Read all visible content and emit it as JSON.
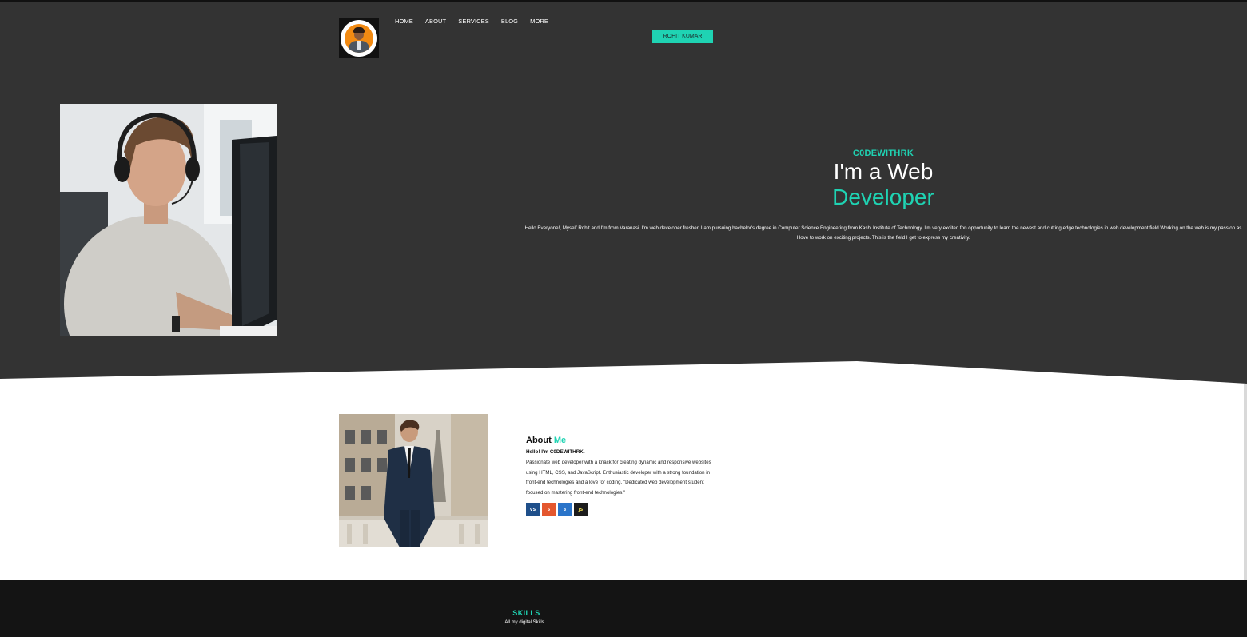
{
  "nav": {
    "items": [
      "HOME",
      "ABOUT",
      "SERVICES",
      "BLOG",
      "MORE"
    ],
    "cta_label": "ROHIT KUMAR"
  },
  "hero": {
    "brand": "C0DEWITHRK",
    "title_line1": "I'm a Web",
    "title_line2": "Developer",
    "intro": "Hello Everyone!, Myself Rohit and I'm from Varanasi. I'm web developer fresher. I am pursuing bachelor's degree in Computer Science Engineering from Kashi Institute of Technology. I'm very excited fon opportunity to learn the newest and cutting edge technologies in web development field.Working on the web is my passion as I love to work on exciting projects. This is the field I get to express my creativity."
  },
  "about": {
    "title_main": "About",
    "title_accent": "Me",
    "greeting": "Hello! I'm C0DEWITHRK.",
    "description": "Passionate web developer with a knack for creating dynamic and responsive websites using HTML, CSS, and JavaScript. Enthusiastic developer with a strong foundation in front-end technologies and a love for coding. \"Dedicated web development student focused on mastering front-end technologies.\" .",
    "tech_icons": [
      "vscode-logo-icon",
      "html5-logo-icon",
      "css3-logo-icon",
      "javascript-logo-icon"
    ],
    "tech_glyphs": [
      "VS",
      "5",
      "3",
      "JS"
    ]
  },
  "skills": {
    "title": "SKILLS",
    "subtitle": "All my digital Skills..."
  },
  "colors": {
    "accent": "#1fd3b3",
    "hero_bg": "#333333",
    "footer_bg": "#141414"
  }
}
